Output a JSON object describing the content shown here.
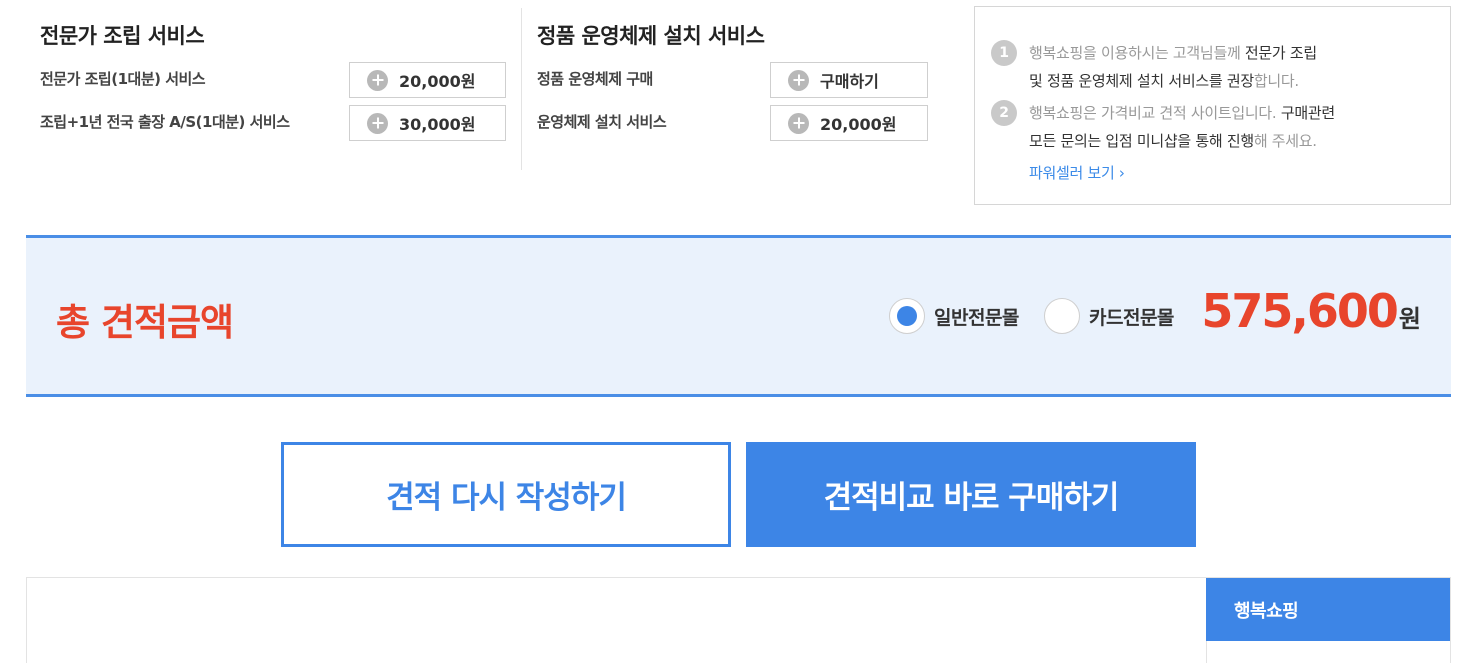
{
  "assembly": {
    "title": "전문가 조립 서비스",
    "rows": [
      {
        "label": "전문가 조립(1대분) 서비스",
        "button": "20,000원"
      },
      {
        "label": "조립+1년 전국 출장 A/S(1대분) 서비스",
        "button": "30,000원"
      }
    ]
  },
  "os": {
    "title": "정품 운영체제 설치 서비스",
    "rows": [
      {
        "label": "정품 운영체제 구매",
        "button": "구매하기"
      },
      {
        "label": "운영체제 설치 서비스",
        "button": "20,000원"
      }
    ]
  },
  "info": {
    "item1": {
      "num": "1",
      "line1_a": "행복쇼핑을 이용하시는 고객님들께 ",
      "line1_b": "전문가 조립",
      "line2_a": "및 정품 운영체제 설치 서비스를 권장",
      "line2_b": "합니다."
    },
    "item2": {
      "num": "2",
      "line1_a": "행복쇼핑은 가격비교 견적 사이트입니다. ",
      "line1_b": "구매관련",
      "line2_a": "모든 문의는 입점 미니샵을 통해 진행",
      "line2_b": "해 주세요."
    },
    "link": "파워셀러 보기 ›"
  },
  "total": {
    "title": "총 견적금액",
    "options": [
      {
        "label": "일반전문몰",
        "selected": true
      },
      {
        "label": "카드전문몰",
        "selected": false
      }
    ],
    "amount": "575,600",
    "unit": "원"
  },
  "actions": {
    "reset": "견적 다시 작성하기",
    "buy": "견적비교 바로 구매하기"
  },
  "bottom": {
    "tab": "행복쇼핑"
  },
  "colors": {
    "accent": "#3d85e6",
    "total_red": "#e8452c",
    "total_bg": "#eaf2fc"
  }
}
